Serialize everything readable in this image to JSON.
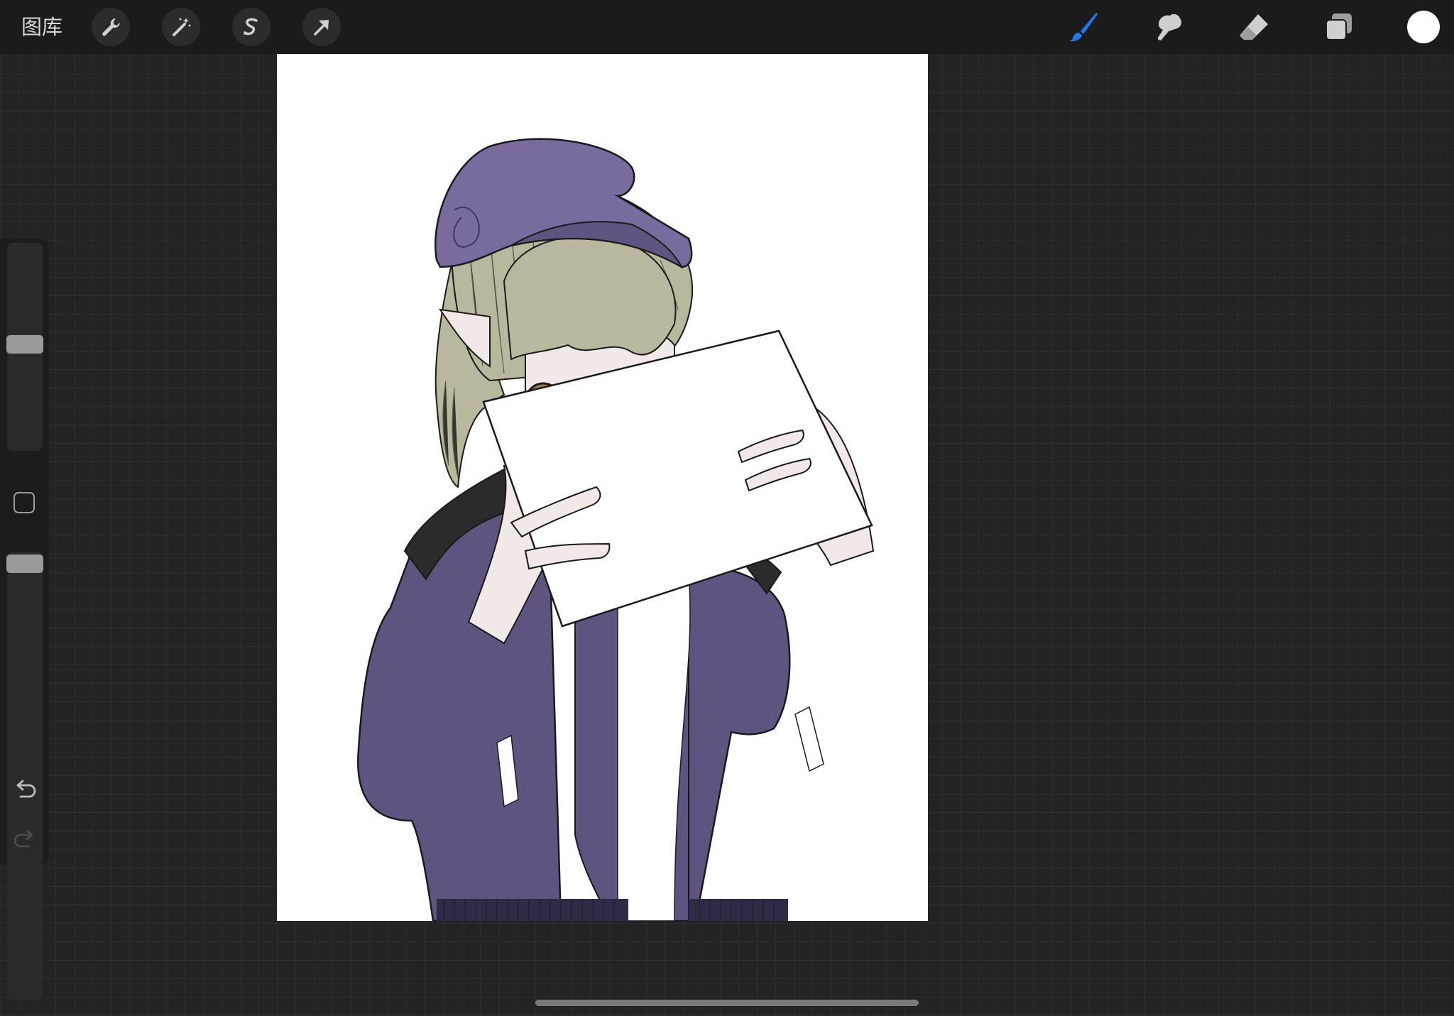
{
  "topbar": {
    "gallery_label": "图库",
    "left_tools": [
      "wrench-icon",
      "magic-wand-icon",
      "selection-icon",
      "transform-arrow-icon"
    ],
    "right_tools": [
      "brush-icon",
      "smudge-icon",
      "eraser-icon",
      "layers-icon"
    ],
    "active_tool": "brush-icon",
    "accent_color": "#1e7bf0",
    "current_color": "#ffffff"
  },
  "sidebar": {
    "brush_size_level": 0.52,
    "opacity_level": 0.05,
    "undo_icon": "undo-arrow-icon",
    "redo_icon": "redo-arrow-icon"
  },
  "canvas": {
    "background_color": "#ffffff",
    "palette": {
      "jacket": "#5f547f",
      "hat": "#7a6b9e",
      "hair": "#b9b79c",
      "skin": "#f1e9e7",
      "eyes": "#a07a4a",
      "shoulder": "#2b2b2b"
    }
  }
}
